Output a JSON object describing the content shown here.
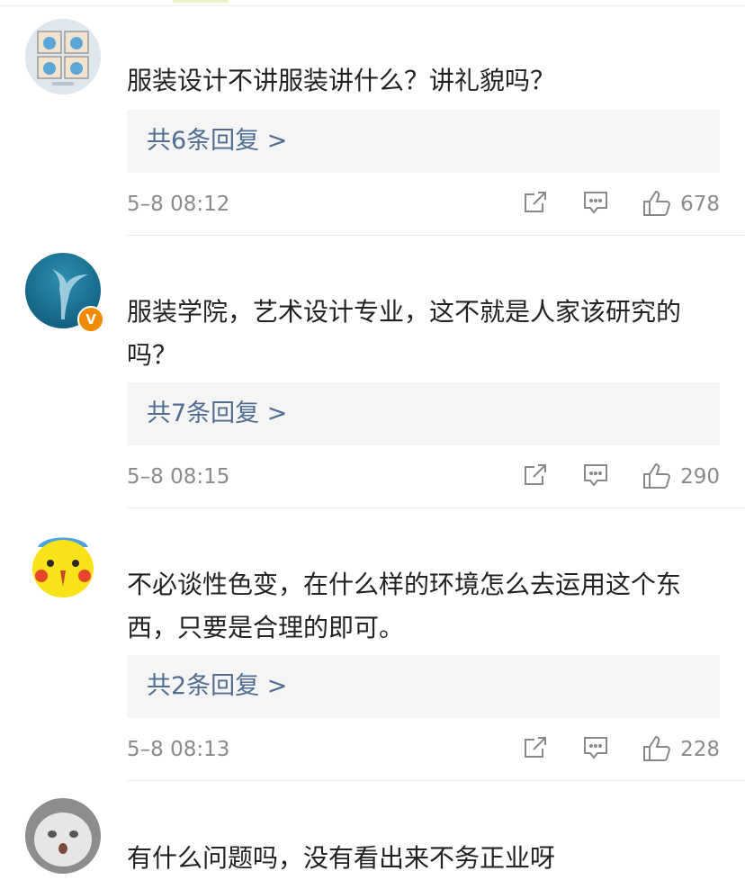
{
  "comments": [
    {
      "text": "服装设计不讲服装讲什么？讲礼貌吗？",
      "replies_label": "共6条回复 >",
      "time": "5–8 08:12",
      "likes": "678",
      "verified": false,
      "avatar": "comic-panels-avatar"
    },
    {
      "text": "服装学院，艺术设计专业，这不就是人家该研究的吗？",
      "replies_label": "共7条回复 >",
      "time": "5–8 08:15",
      "likes": "290",
      "verified": true,
      "avatar": "whale-tail-avatar"
    },
    {
      "text": "不必谈性色变，在什么样的环境怎么去运用这个东西，只要是合理的即可。",
      "replies_label": "共2条回复 >",
      "time": "5–8 08:13",
      "likes": "228",
      "verified": false,
      "avatar": "pikachu-avatar"
    },
    {
      "text": "有什么问题吗，没有看出来不务正业呀",
      "avatar": "white-cat-avatar"
    }
  ],
  "icons": {
    "share": "share-icon",
    "comment": "comment-icon",
    "like": "thumbs-up-icon",
    "verified": "verified-badge-icon"
  },
  "colors": {
    "link": "#506d92",
    "meta": "#8a8a8a",
    "reply_bg": "#f5f5f5",
    "badge": "#f08a00"
  }
}
